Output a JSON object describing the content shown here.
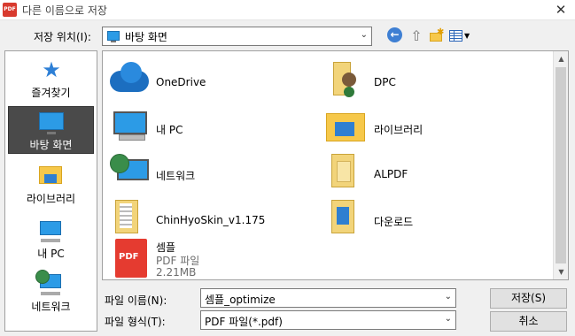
{
  "window": {
    "title": "다른 이름으로 저장",
    "app_icon_text": "PDF",
    "close": "✕"
  },
  "lookin": {
    "label": "저장 위치(I):",
    "value": "바탕 화면"
  },
  "places": [
    {
      "label": "즐겨찾기",
      "icon": "star-icon"
    },
    {
      "label": "바탕 화면",
      "icon": "desktop-icon",
      "selected": true
    },
    {
      "label": "라이브러리",
      "icon": "library-icon"
    },
    {
      "label": "내 PC",
      "icon": "computer-icon"
    },
    {
      "label": "네트워크",
      "icon": "network-icon"
    }
  ],
  "files": [
    {
      "name": "OneDrive",
      "icon": "cloud-icon"
    },
    {
      "name": "DPC",
      "icon": "user-folder-icon"
    },
    {
      "name": "내 PC",
      "icon": "computer-icon"
    },
    {
      "name": "라이브러리",
      "icon": "library-folder-icon"
    },
    {
      "name": "네트워크",
      "icon": "network-icon"
    },
    {
      "name": "ALPDF",
      "icon": "folder-icon"
    },
    {
      "name": "ChinHyoSkin_v1.175",
      "icon": "zip-folder-icon"
    },
    {
      "name": "다운로드",
      "icon": "download-folder-icon"
    },
    {
      "name": "셈플",
      "type": "PDF 파일",
      "size": "2.21MB",
      "icon": "pdf-file-icon",
      "icon_text": "PDF"
    }
  ],
  "filename": {
    "label": "파일 이름(N):",
    "value": "셈플_optimize"
  },
  "filetype": {
    "label": "파일 형식(T):",
    "value": "PDF 파일(*.pdf)"
  },
  "buttons": {
    "save": "저장(S)",
    "cancel": "취소"
  }
}
